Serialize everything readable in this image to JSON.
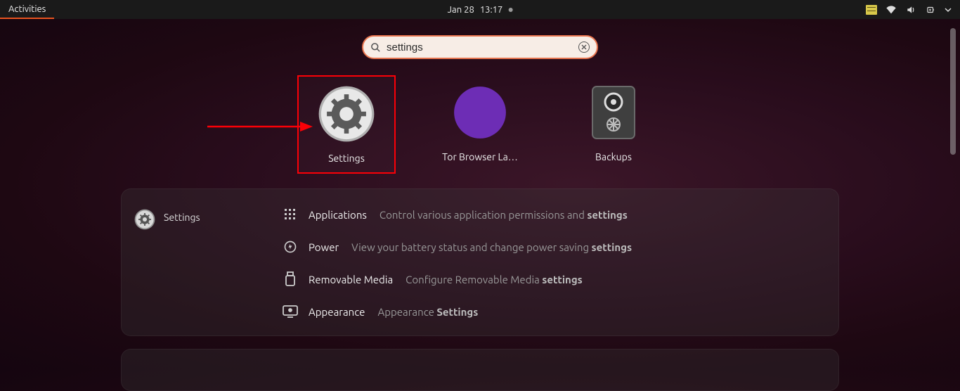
{
  "topbar": {
    "activities": "Activities",
    "date": "Jan 28",
    "time": "13:17"
  },
  "search": {
    "value": "settings",
    "placeholder": ""
  },
  "apps": [
    {
      "label": "Settings"
    },
    {
      "label": "Tor Browser La…"
    },
    {
      "label": "Backups"
    }
  ],
  "panel": {
    "header": "Settings",
    "rows": [
      {
        "title": "Applications",
        "desc_pre": "Control various application permissions and ",
        "desc_bold": "settings"
      },
      {
        "title": "Power",
        "desc_pre": "View your battery status and change power saving ",
        "desc_bold": "settings"
      },
      {
        "title": "Removable Media",
        "desc_pre": "Configure Removable Media ",
        "desc_bold": "settings"
      },
      {
        "title": "Appearance",
        "desc_pre": "Appearance ",
        "desc_bold": "Settings"
      }
    ]
  }
}
